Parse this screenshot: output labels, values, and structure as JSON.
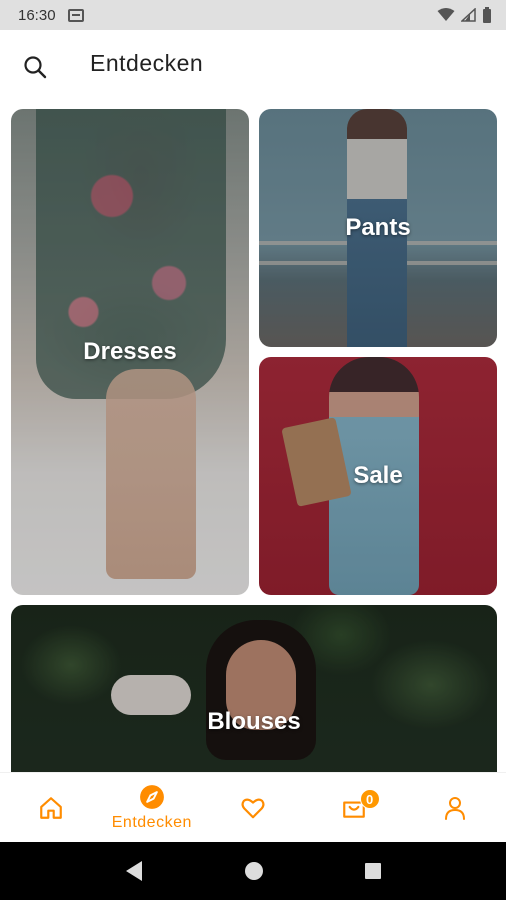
{
  "status_bar": {
    "time": "16:30"
  },
  "header": {
    "title": "Entdecken",
    "search_icon": "search-icon"
  },
  "categories": [
    {
      "label": "Dresses"
    },
    {
      "label": "Pants"
    },
    {
      "label": "Sale"
    },
    {
      "label": "Blouses"
    }
  ],
  "bottom_nav": {
    "items": [
      {
        "icon": "home-icon",
        "label": ""
      },
      {
        "icon": "compass-icon",
        "label": "Entdecken"
      },
      {
        "icon": "heart-icon",
        "label": ""
      },
      {
        "icon": "cart-icon",
        "label": "",
        "badge": "0"
      },
      {
        "icon": "profile-icon",
        "label": ""
      }
    ]
  },
  "colors": {
    "accent": "#ff8c00",
    "badge": "#ff9800"
  }
}
